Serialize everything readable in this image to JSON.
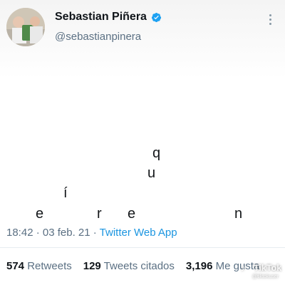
{
  "author": {
    "display_name": "Sebastian Piñera",
    "handle": "@sebastianpinera",
    "verified_icon": "verified-badge-icon",
    "avatar_icon": "profile-avatar"
  },
  "tweet": {
    "letters": [
      {
        "char": "q"
      },
      {
        "char": "u"
      },
      {
        "char": "í"
      },
      {
        "char": "e"
      },
      {
        "char": "r"
      },
      {
        "char": "e"
      },
      {
        "char": "n"
      }
    ],
    "time_date": "18:42 · 03 feb. 21 · ",
    "source": "Twitter Web App"
  },
  "stats": {
    "retweets_count": "574",
    "retweets_label": "Retweets",
    "quotes_count": "129",
    "quotes_label": "Tweets citados",
    "likes_count": "3,196",
    "likes_label": "Me gusta"
  },
  "watermark": {
    "logo_icon": "tiktok-logo",
    "text": "TikTok",
    "sub": "@tiktokuser"
  },
  "colors": {
    "link": "#1b95e0",
    "secondary_text": "#5b7083",
    "primary_text": "#0f1419",
    "verified": "#1da1f2"
  }
}
